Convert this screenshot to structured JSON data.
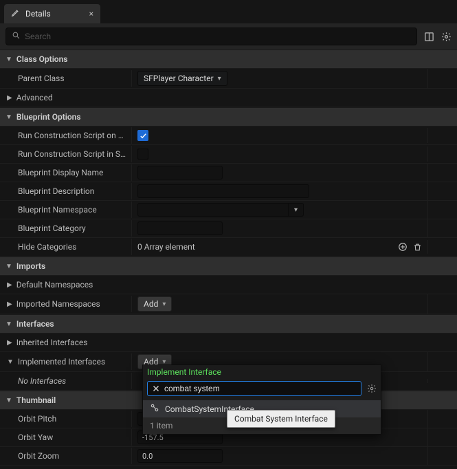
{
  "tab": {
    "title": "Details",
    "close_glyph": "×"
  },
  "search": {
    "placeholder": "Search"
  },
  "sections": {
    "class_options": {
      "title": "Class Options",
      "parent_class": {
        "label": "Parent Class",
        "value": "SFPlayer Character"
      },
      "advanced": "Advanced"
    },
    "blueprint_options": {
      "title": "Blueprint Options",
      "run_con_drag": {
        "label": "Run Construction Script on Drag",
        "checked": true
      },
      "run_con_seq": {
        "label": "Run Construction Script in Seq…",
        "checked": false
      },
      "display_name": {
        "label": "Blueprint Display Name",
        "value": ""
      },
      "description": {
        "label": "Blueprint Description",
        "value": ""
      },
      "namespace": {
        "label": "Blueprint Namespace",
        "value": ""
      },
      "category": {
        "label": "Blueprint Category",
        "value": ""
      },
      "hide_cats": {
        "label": "Hide Categories",
        "value": "0 Array element"
      }
    },
    "imports": {
      "title": "Imports",
      "default_ns": "Default Namespaces",
      "imported_ns": {
        "label": "Imported Namespaces",
        "button": "Add"
      }
    },
    "interfaces": {
      "title": "Interfaces",
      "inherited": "Inherited Interfaces",
      "implemented": {
        "label": "Implemented Interfaces",
        "button": "Add"
      },
      "none": "No Interfaces"
    },
    "thumbnail": {
      "title": "Thumbnail",
      "orbit_pitch": {
        "label": "Orbit Pitch",
        "value": ""
      },
      "orbit_yaw": {
        "label": "Orbit Yaw",
        "value": "-157.5"
      },
      "orbit_zoom": {
        "label": "Orbit Zoom",
        "value": "0.0"
      }
    }
  },
  "popup": {
    "title": "Implement Interface",
    "search_value": "combat system",
    "items": [
      "CombatSystemInterface"
    ],
    "footer": "1 item",
    "tooltip": "Combat System Interface"
  }
}
